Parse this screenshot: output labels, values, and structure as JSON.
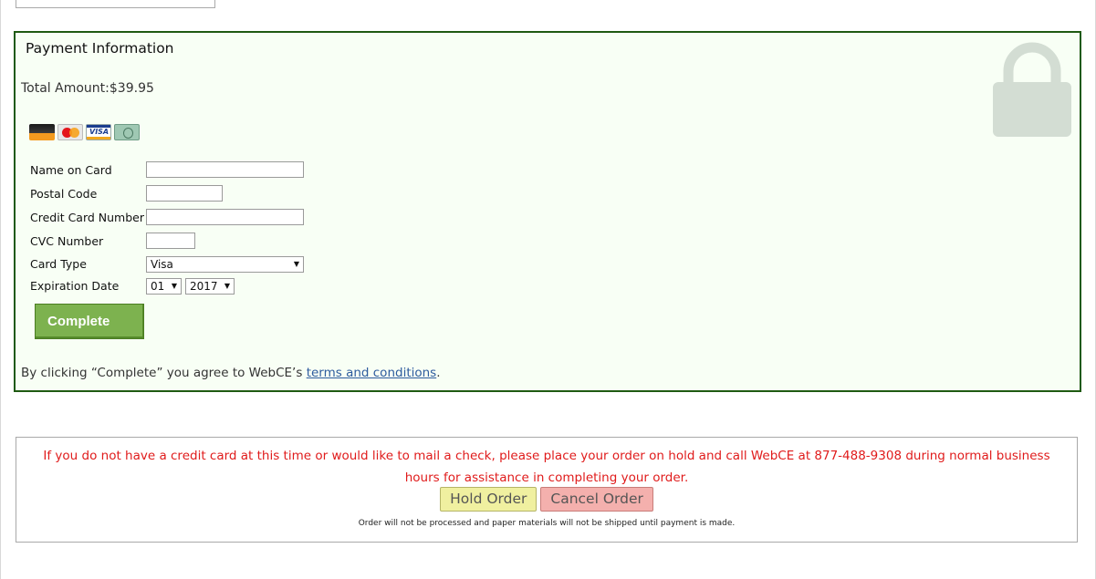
{
  "payment": {
    "title": "Payment Information",
    "total_label": "Total Amount:",
    "total_value": "$39.95",
    "card_logos": [
      "discover-card-icon",
      "mastercard-icon",
      "visa-card-icon",
      "amex-card-icon"
    ],
    "visa_text": "VISA",
    "fields": {
      "name_label": "Name on Card",
      "name_value": "",
      "postal_label": "Postal Code",
      "postal_value": "",
      "card_number_label": "Credit Card Number",
      "card_number_value": "",
      "cvc_label": "CVC Number",
      "cvc_value": "",
      "card_type_label": "Card Type",
      "card_type_value": "Visa",
      "expiration_label": "Expiration Date",
      "exp_month_value": "01",
      "exp_year_value": "2017"
    },
    "complete_label": "Complete",
    "agree_prefix": "By clicking “Complete” you agree to WebCE’s ",
    "terms_link": "terms and conditions",
    "agree_suffix": "."
  },
  "hold": {
    "message": "If you do not have a credit card at this time or would like to mail a check, please place your order on hold and call WebCE at 877-488-9308 during normal business hours for assistance in completing your order.",
    "hold_label": "Hold Order",
    "cancel_label": "Cancel Order",
    "note": "Order will not be processed and paper materials will not be shipped until payment is made."
  },
  "colors": {
    "panel_border": "#1f5a12",
    "panel_bg": "#f8fff5",
    "complete_button": "#7db24f",
    "hold_button": "#f0f0a0",
    "cancel_button": "#f4b0ad",
    "warning_text": "#e01b1b",
    "link": "#2e5b9e",
    "lock_icon": "#d3ddd3"
  }
}
